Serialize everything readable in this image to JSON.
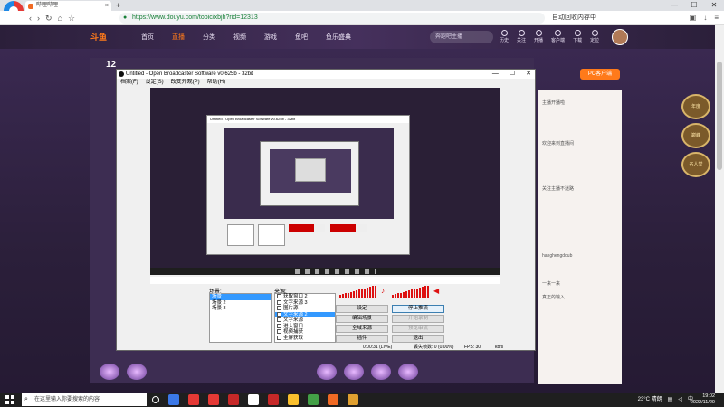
{
  "browser": {
    "tab_title": "哔哩哔哩",
    "tab_close": "×",
    "new_tab": "+",
    "url": "https://www.douyu.com/topic/xbjh?rid=12313",
    "right_text": "自动回收内存中",
    "nav_back": "‹",
    "nav_forward": "›",
    "nav_refresh": "↻",
    "nav_home": "⌂",
    "nav_bookmark": "☆",
    "win_min": "—",
    "win_max": "☐",
    "win_close": "✕"
  },
  "site": {
    "logo": "斗鱼",
    "nav": [
      "首页",
      "直播",
      "分类",
      "视频",
      "游戏",
      "鱼吧",
      "鱼乐盛典"
    ],
    "search_placeholder": "奔跑吧主播",
    "icons": [
      "历史",
      "关注",
      "开播",
      "客户端",
      "下载",
      "定位"
    ],
    "room_number": "12",
    "pc_client": "PC客户端",
    "chat_lines": [
      "主播开播啦",
      "欢迎来到直播间",
      "关注主播不迷路",
      "hanghengdoub",
      "一来一来",
      "真正的输入"
    ],
    "rank_badges": [
      "年度",
      "巅峰",
      "名人堂"
    ]
  },
  "obs": {
    "title": "Untitled - Open Broadcaster Software v0.625b - 32bit",
    "win_min": "—",
    "win_max": "☐",
    "win_close": "✕",
    "menu": [
      "档案(F)",
      "设定(S)",
      "改变外观(P)",
      "帮助(H)"
    ],
    "preview_title": "Untitled - Open Broadcaster Software v0.625b - 32bit",
    "scenes_label": "场景:",
    "sources_label": "来源:",
    "scenes": [
      {
        "name": "场景",
        "selected": true
      },
      {
        "name": "场景 2",
        "selected": false
      },
      {
        "name": "场景 3",
        "selected": false
      }
    ],
    "sources": [
      {
        "name": "获取窗口 2",
        "selected": false
      },
      {
        "name": "文字来源 3",
        "selected": false
      },
      {
        "name": "图片源",
        "selected": false
      },
      {
        "name": "文字来源 2",
        "selected": true
      },
      {
        "name": "文字来源",
        "selected": false
      },
      {
        "name": "进入窗口",
        "selected": false
      },
      {
        "name": "视频捕获",
        "selected": false
      },
      {
        "name": "全屏获取",
        "selected": false
      }
    ],
    "buttons": {
      "settings": "设定",
      "stop_stream": "停止推流",
      "edit_scene": "编辑场景",
      "start_recording": "开始录制",
      "global_sources": "全域来源",
      "preview": "预览串流",
      "plugins": "插件",
      "exit": "退出"
    },
    "status": {
      "time": "0:00:31 (LIVE)",
      "dropped": "丢失帧数: 0 (0.00%)",
      "fps": "FPS: 30",
      "bitrate": "kb/s"
    }
  },
  "taskbar": {
    "search_placeholder": "在这里输入你要搜索的内容",
    "search_icon": "⌕",
    "weather": "23°C 晴朗",
    "ime": "中",
    "time": "19:02",
    "date": "2022/11/20",
    "app_colors": [
      "#ffffff",
      "#3b78e7",
      "#e53935",
      "#e53935",
      "#c62828",
      "#ffffff",
      "#c62828",
      "#fbc02d",
      "#43a047",
      "#f06a24",
      "#e0a030"
    ]
  },
  "colors": {
    "douyu_accent": "#ff7a1a",
    "obs_meter": "#dd1111",
    "selection": "#3399ff"
  }
}
